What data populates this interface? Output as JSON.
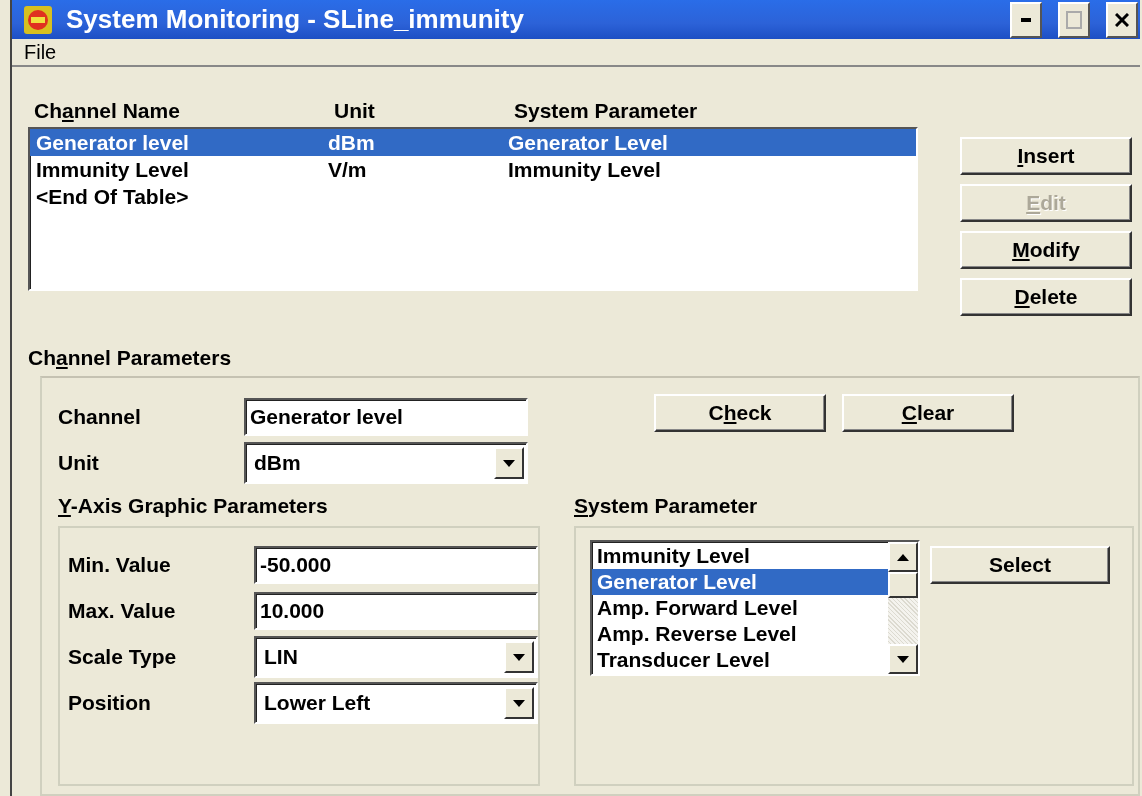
{
  "window": {
    "title": "System Monitoring - SLine_immunity"
  },
  "menu": [
    {
      "label": "File"
    }
  ],
  "channel_table": {
    "columns": [
      {
        "before": "Ch",
        "mnemonic": "a",
        "after": "nnel Name"
      },
      {
        "before": "Unit"
      },
      {
        "before": "System Parameter"
      }
    ],
    "rows": [
      {
        "cells": [
          "Generator level",
          "dBm",
          "Generator Level"
        ],
        "selected": true
      },
      {
        "cells": [
          "Immunity Level",
          "V/m",
          "Immunity Level"
        ],
        "selected": false
      },
      {
        "cells": [
          "<End Of Table>"
        ],
        "selected": false
      }
    ]
  },
  "table_buttons": [
    {
      "mnemonic": "I",
      "after": "nsert",
      "disabled": false
    },
    {
      "mnemonic": "E",
      "after": "dit",
      "disabled": true
    },
    {
      "mnemonic": "M",
      "after": "odify",
      "disabled": false
    },
    {
      "mnemonic": "D",
      "after": "elete",
      "disabled": false
    }
  ],
  "channel_parameters": {
    "title": {
      "before": "Ch",
      "mnemonic": "a",
      "after": "nnel Parameters"
    },
    "fields": [
      {
        "kind": "text",
        "label": "Channel",
        "value": "Generator level"
      },
      {
        "kind": "dropdown",
        "label": "Unit",
        "value": "dBm"
      }
    ],
    "buttons": [
      {
        "before": "C",
        "mnemonic": "h",
        "after": "eck",
        "disabled": false
      },
      {
        "mnemonic": "C",
        "after": "lear",
        "disabled": false
      }
    ],
    "y_axis": {
      "title": {
        "mnemonic": "Y",
        "after": "-Axis Graphic Parameters"
      },
      "fields": [
        {
          "kind": "text",
          "label": "Min. Value",
          "value": "-50.000"
        },
        {
          "kind": "text",
          "label": "Max. Value",
          "value": "10.000"
        },
        {
          "kind": "dropdown",
          "label": "Scale Type",
          "value": "LIN"
        },
        {
          "kind": "dropdown",
          "label": "Position",
          "value": "Lower Left"
        }
      ]
    },
    "system_parameter": {
      "title": {
        "mnemonic": "S",
        "after": "ystem Parameter"
      },
      "items": [
        {
          "label": "Immunity Level",
          "selected": false
        },
        {
          "label": "Generator Level",
          "selected": true
        },
        {
          "label": "Amp. Forward Level",
          "selected": false
        },
        {
          "label": "Amp. Reverse Level",
          "selected": false
        },
        {
          "label": "Transducer Level",
          "selected": false
        }
      ],
      "button": {
        "before": "Select",
        "disabled": false
      }
    }
  }
}
